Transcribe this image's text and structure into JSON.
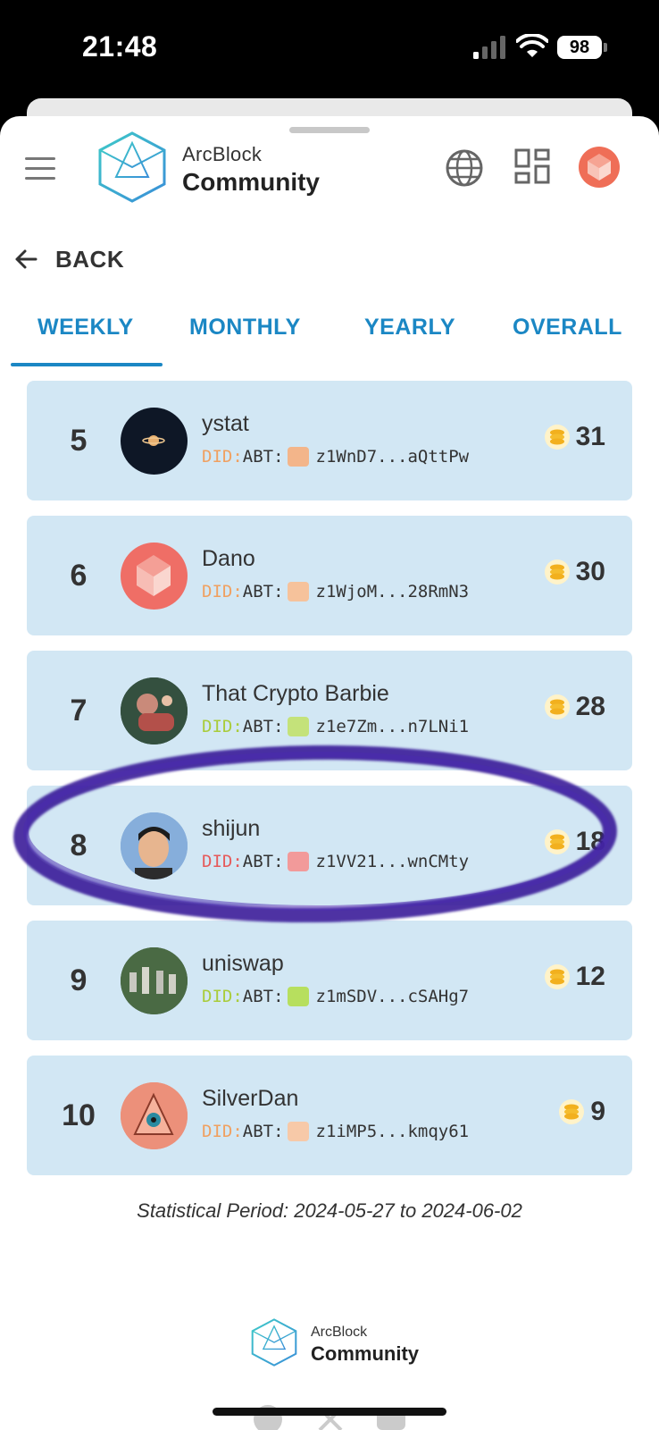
{
  "status_bar": {
    "time": "21:48",
    "battery": "98"
  },
  "header": {
    "brand_top": "ArcBlock",
    "brand_bottom": "Community",
    "icons": [
      "menu-icon",
      "globe-icon",
      "apps-grid-icon",
      "user-avatar"
    ]
  },
  "back": {
    "label": "BACK"
  },
  "tabs": [
    {
      "label": "WEEKLY",
      "selected": true
    },
    {
      "label": "MONTHLY",
      "selected": false
    },
    {
      "label": "YEARLY",
      "selected": false
    },
    {
      "label": "OVERALL",
      "selected": false
    }
  ],
  "leaderboard": [
    {
      "rank": "5",
      "name": "ystat",
      "did_prefix": "DID:",
      "did_type": "ABT:",
      "did": "z1WnD7...aQttPw",
      "score": "31",
      "prefix_color": "orange"
    },
    {
      "rank": "6",
      "name": "Dano",
      "did_prefix": "DID:",
      "did_type": "ABT:",
      "did": "z1WjoM...28RmN3",
      "score": "30",
      "prefix_color": "orange"
    },
    {
      "rank": "7",
      "name": "That Crypto Barbie",
      "did_prefix": "DID:",
      "did_type": "ABT:",
      "did": "z1e7Zm...n7LNi1",
      "score": "28",
      "prefix_color": "green"
    },
    {
      "rank": "8",
      "name": "shijun",
      "did_prefix": "DID:",
      "did_type": "ABT:",
      "did": "z1VV21...wnCMty",
      "score": "18",
      "prefix_color": "red"
    },
    {
      "rank": "9",
      "name": "uniswap",
      "did_prefix": "DID:",
      "did_type": "ABT:",
      "did": "z1mSDV...cSAHg7",
      "score": "12",
      "prefix_color": "green"
    },
    {
      "rank": "10",
      "name": "SilverDan",
      "did_prefix": "DID:",
      "did_type": "ABT:",
      "did": "z1iMP5...kmqy61",
      "score": "9",
      "prefix_color": "orange"
    }
  ],
  "period": "Statistical Period: 2024-05-27 to 2024-06-02",
  "footer": {
    "brand_top": "ArcBlock",
    "brand_bottom": "Community"
  },
  "colors": {
    "accent": "#1b87c4",
    "row_bg": "#d2e7f4",
    "highlight": "#3a1f9a"
  }
}
